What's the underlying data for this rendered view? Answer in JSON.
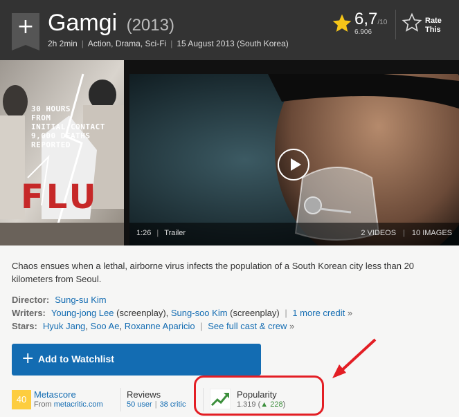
{
  "header": {
    "title": "Gamgi",
    "year": "(2013)",
    "runtime": "2h 2min",
    "genres": "Action, Drama, Sci-Fi",
    "release": "15 August 2013 (South Korea)",
    "rating": "6,7",
    "rating_max": "/10",
    "rating_count": "6.906",
    "rate_label": "Rate This",
    "star_color": "#f5c518",
    "bookmark_plus": "+"
  },
  "poster": {
    "tagline": "30 HOURS\nFROM\nINITIAL CONTACT\n9,000 DEATHS\nREPORTED",
    "logo": "FLU"
  },
  "video": {
    "duration": "1:26",
    "label": "Trailer",
    "videos_link": "2 VIDEOS",
    "images_link": "10 IMAGES"
  },
  "summary": "Chaos ensues when a lethal, airborne virus infects the population of a South Korean city less than 20 kilometers from Seoul.",
  "credits": {
    "director_label": "Director:",
    "director": "Sung-su Kim",
    "writers_label": "Writers:",
    "writer1": "Young-jong Lee",
    "writer1_role": "(screenplay),",
    "writer2": "Sung-soo Kim",
    "writer2_role": "(screenplay)",
    "more_credit": "1 more credit",
    "stars_label": "Stars:",
    "star1": "Hyuk Jang",
    "star2": "Soo Ae",
    "star3": "Roxanne Aparicio",
    "full_cast": "See full cast & crew",
    "gt": "»",
    "comma": ","
  },
  "watchlist": {
    "plus": "+",
    "label": "Add to Watchlist"
  },
  "metascore": {
    "score": "40",
    "title": "Metascore",
    "from_text": "From",
    "from_link": "metacritic.com",
    "color": "#fdcd3f"
  },
  "reviews": {
    "title": "Reviews",
    "user": "50 user",
    "critic": "38 critic"
  },
  "popularity": {
    "title": "Popularity",
    "value": "1.319",
    "change": "228",
    "up_arrow": "▲"
  },
  "colors": {
    "header_bg": "#333333",
    "link": "#136cb2",
    "watchlist_bg": "#136cb2",
    "annotation": "#e31e24"
  }
}
